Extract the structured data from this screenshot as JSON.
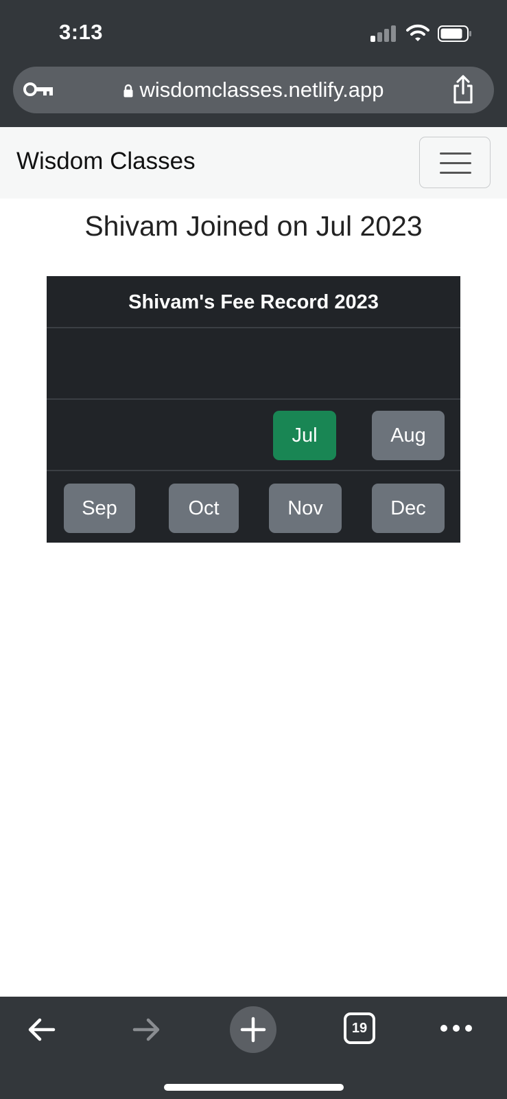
{
  "status_bar": {
    "time": "3:13"
  },
  "browser": {
    "url": "wisdomclasses.netlify.app",
    "tab_count": "19"
  },
  "navbar": {
    "brand": "Wisdom Classes"
  },
  "page": {
    "joined_title": "Shivam Joined on Jul 2023",
    "fee_table_title": "Shivam's Fee Record 2023",
    "months": {
      "jul": "Jul",
      "aug": "Aug",
      "sep": "Sep",
      "oct": "Oct",
      "nov": "Nov",
      "dec": "Dec"
    }
  },
  "colors": {
    "chrome": "#33373b",
    "paid": "#198654",
    "unpaid": "#6c737b",
    "table_bg": "#212428"
  }
}
